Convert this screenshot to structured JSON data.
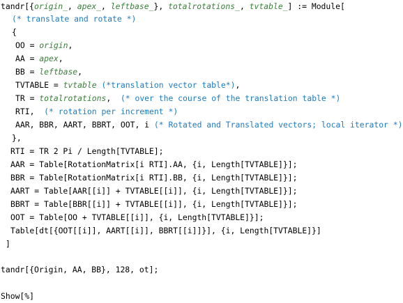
{
  "colors": {
    "text": "#000000",
    "pattern": "#3a7f3a",
    "comment": "#1f7bbf",
    "background": "#ffffff"
  },
  "code": {
    "l01": {
      "t1": "tandr[{",
      "p1": "origin_",
      "t2": ", ",
      "p2": "apex_",
      "t3": ", ",
      "p3": "leftbase_",
      "t4": "}, ",
      "p4": "totalrotations_",
      "t5": ", ",
      "p5": "tvtable_",
      "t6": "] := Module["
    },
    "l02": {
      "cm": "(* translate and rotate *)"
    },
    "l03": {
      "t1": "{"
    },
    "l04": {
      "t1": "OO = ",
      "p1": "origin",
      "t2": ","
    },
    "l05": {
      "t1": "AA = ",
      "p1": "apex",
      "t2": ","
    },
    "l06": {
      "t1": "BB = ",
      "p1": "leftbase",
      "t2": ","
    },
    "l07": {
      "t1": "TVTABLE = ",
      "p1": "tvtable",
      "t2": " ",
      "cm": "(*translation vector table*)",
      "t3": ","
    },
    "l08": {
      "t1": "TR = ",
      "p1": "totalrotations",
      "t2": ",  ",
      "cm": "(* over the course of the translation table *)"
    },
    "l09": {
      "t1": "RTI,  ",
      "cm": "(* rotation per increment *)"
    },
    "l10": {
      "t1": "AAR, BBR, AART, BBRT, OOT, i ",
      "cm": "(* Rotated and Translated vectors; local iterator *)"
    },
    "l11": {
      "t1": "},"
    },
    "l12": {
      "t1": "RTI = TR 2 Pi / Length[TVTABLE];"
    },
    "l13": {
      "t1": "AAR = Table[RotationMatrix[i RTI].AA, {i, Length[TVTABLE]}];"
    },
    "l14": {
      "t1": "BBR = Table[RotationMatrix[i RTI].BB, {i, Length[TVTABLE]}];"
    },
    "l15": {
      "t1": "AART = Table[AAR[[i]] + TVTABLE[[i]], {i, Length[TVTABLE]}];"
    },
    "l16": {
      "t1": "BBRT = Table[BBR[[i]] + TVTABLE[[i]], {i, Length[TVTABLE]}];"
    },
    "l17": {
      "t1": "OOT = Table[OO + TVTABLE[[i]], {i, Length[TVTABLE]}];"
    },
    "l18": {
      "t1": "Table[dt[{OOT[[i]], AART[[i]], BBRT[[i]]}], {i, Length[TVTABLE]}]"
    },
    "l19": {
      "t1": "]"
    },
    "l20": {
      "t1": "tandr[{Origin, AA, BB}, 128, ot];"
    },
    "l21": {
      "t1": "Show[%]"
    }
  }
}
